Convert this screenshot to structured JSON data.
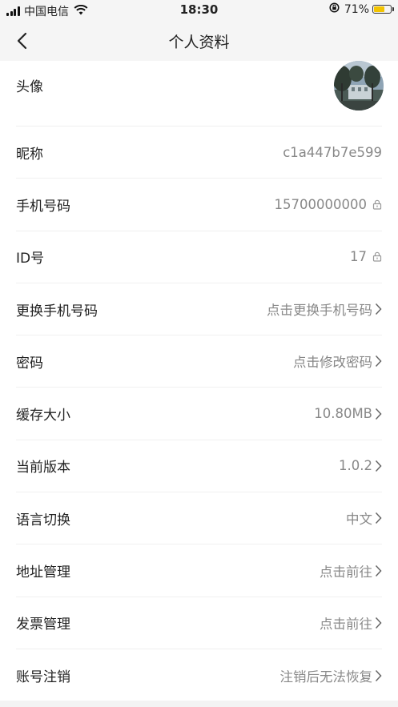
{
  "status_bar": {
    "carrier": "中国电信",
    "time": "18:30",
    "battery_percent": "71%",
    "battery_level": 0.71
  },
  "nav": {
    "title": "个人资料"
  },
  "rows": [
    {
      "label": "头像"
    },
    {
      "label": "昵称",
      "value": "c1a447b7e599"
    },
    {
      "label": "手机号码",
      "value": "15700000000",
      "icon": "lock-icon"
    },
    {
      "label": "ID号",
      "value": "17",
      "icon": "lock-icon"
    },
    {
      "label": "更换手机号码",
      "value": "点击更换手机号码",
      "icon": "chevron-right-icon"
    },
    {
      "label": "密码",
      "value": "点击修改密码",
      "icon": "chevron-right-icon"
    },
    {
      "label": "缓存大小",
      "value": "10.80MB",
      "icon": "chevron-right-icon"
    },
    {
      "label": "当前版本",
      "value": "1.0.2",
      "icon": "chevron-right-icon"
    },
    {
      "label": "语言切换",
      "value": "中文",
      "icon": "chevron-right-icon"
    },
    {
      "label": "地址管理",
      "value": "点击前往",
      "icon": "chevron-right-icon"
    },
    {
      "label": "发票管理",
      "value": "点击前往",
      "icon": "chevron-right-icon"
    },
    {
      "label": "账号注销",
      "value": "注销后无法恢复",
      "icon": "chevron-right-icon"
    }
  ]
}
